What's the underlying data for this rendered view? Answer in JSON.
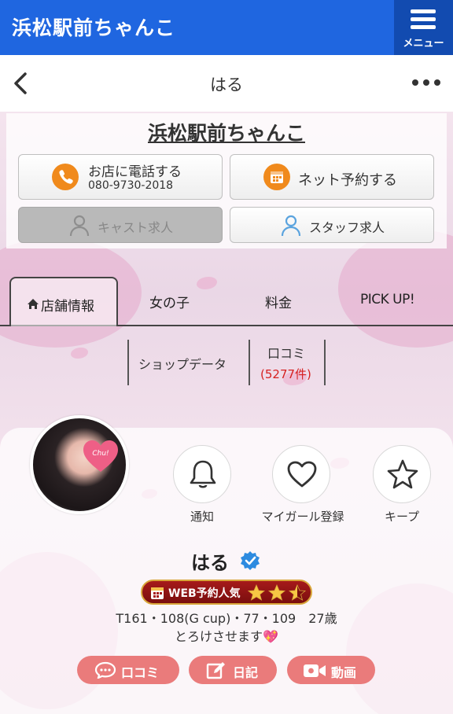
{
  "appbar": {
    "title": "浜松駅前ちゃんこ",
    "menu_label": "メニュー"
  },
  "navbar": {
    "title": "はる"
  },
  "shop": {
    "name": "浜松駅前ちゃんこ",
    "call_label": "お店に電話する",
    "call_number": "080-9730-2018",
    "reserve_label": "ネット予約する",
    "cast_recruit_label": "キャスト求人",
    "staff_recruit_label": "スタッフ求人"
  },
  "tabs": [
    {
      "label": "店舗情報",
      "active": true
    },
    {
      "label": "女の子"
    },
    {
      "label": "料金"
    },
    {
      "label": "PICK UP!"
    }
  ],
  "sub_tabs": {
    "shop_data": "ショップデータ",
    "review_label": "口コミ",
    "review_count": "(5277件)"
  },
  "profile": {
    "name": "はる",
    "avatar_badge": "Chu!",
    "actions": [
      {
        "label": "通知",
        "icon": "bell-icon"
      },
      {
        "label": "マイガール登録",
        "icon": "heart-icon"
      },
      {
        "label": "キープ",
        "icon": "star-icon"
      }
    ],
    "rank_label": "WEB予約人気",
    "rank_stars": 2.5,
    "stats": "T161・108(G cup)・77・109　27歳",
    "catchphrase": "とろけさせます💖",
    "buttons": [
      {
        "label": "口コミ",
        "icon": "chat-icon"
      },
      {
        "label": "日記",
        "icon": "edit-icon"
      },
      {
        "label": "動画",
        "icon": "video-icon"
      }
    ]
  },
  "colors": {
    "appbar": "#1f66e0",
    "menu": "#124bb0",
    "accent_orange": "#f08a1c",
    "pill": "#ea7b7b",
    "review_count": "#d62020"
  }
}
